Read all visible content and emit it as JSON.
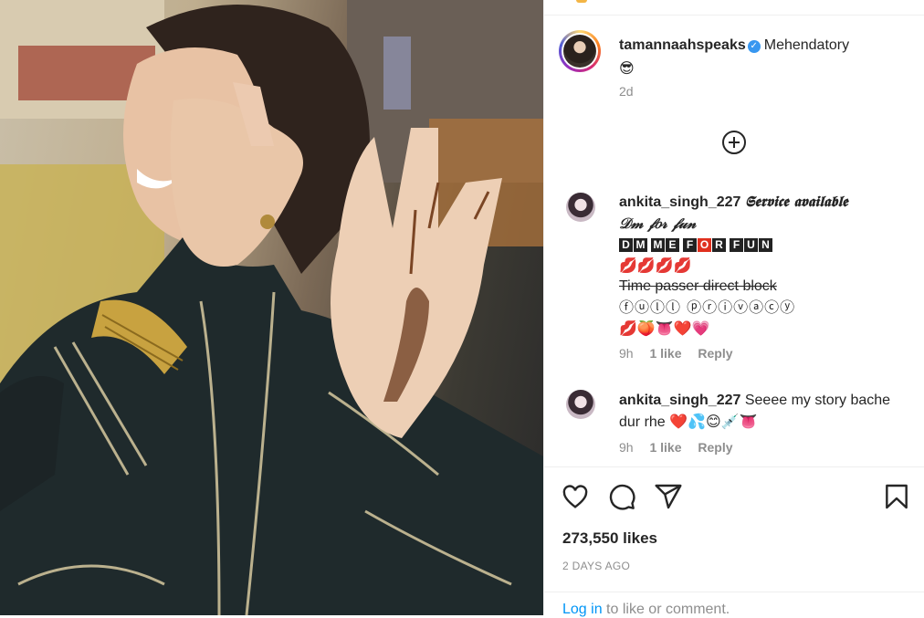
{
  "post": {
    "username": "tamannaahspeaks",
    "caption": "Mehendatory",
    "caption_emoji": "😎",
    "time_ago": "2d",
    "verified_icon": "verified-badge-icon"
  },
  "load_more_icon": "plus-circle-icon",
  "comments": [
    {
      "username": "ankita_singh_227",
      "line1": "𝕾𝖊𝖗𝖛𝖎𝖈𝖊 𝖆𝖛𝖆𝖎𝖑𝖆𝖇𝖑𝖊",
      "line2": "𝒟𝓂 𝒻𝑜𝓇 𝒻𝓊𝓃",
      "boxed_letters": [
        "D",
        "M",
        "M",
        "E",
        "F",
        "O",
        "R",
        "F",
        "U",
        "N"
      ],
      "lips": "💋💋💋💋",
      "struck": "Time passer direct block",
      "circled": "ⓕⓤⓛⓛ ⓟⓡⓘⓥⓐⓒⓨ",
      "emoji_row": "💋🍑👅❤️💗",
      "time": "9h",
      "likes": "1 like",
      "reply": "Reply"
    },
    {
      "username": "ankita_singh_227",
      "text": "Seeee my story bache dur rhe",
      "emojis": "❤️💦😊💉👅",
      "time": "9h",
      "likes": "1 like",
      "reply": "Reply"
    }
  ],
  "actions": {
    "icons": [
      "heart-icon",
      "comment-icon",
      "share-icon",
      "bookmark-icon"
    ],
    "likes": "273,550 likes",
    "date": "2 DAYS AGO"
  },
  "login": {
    "link": "Log in",
    "rest": "to like or comment."
  }
}
